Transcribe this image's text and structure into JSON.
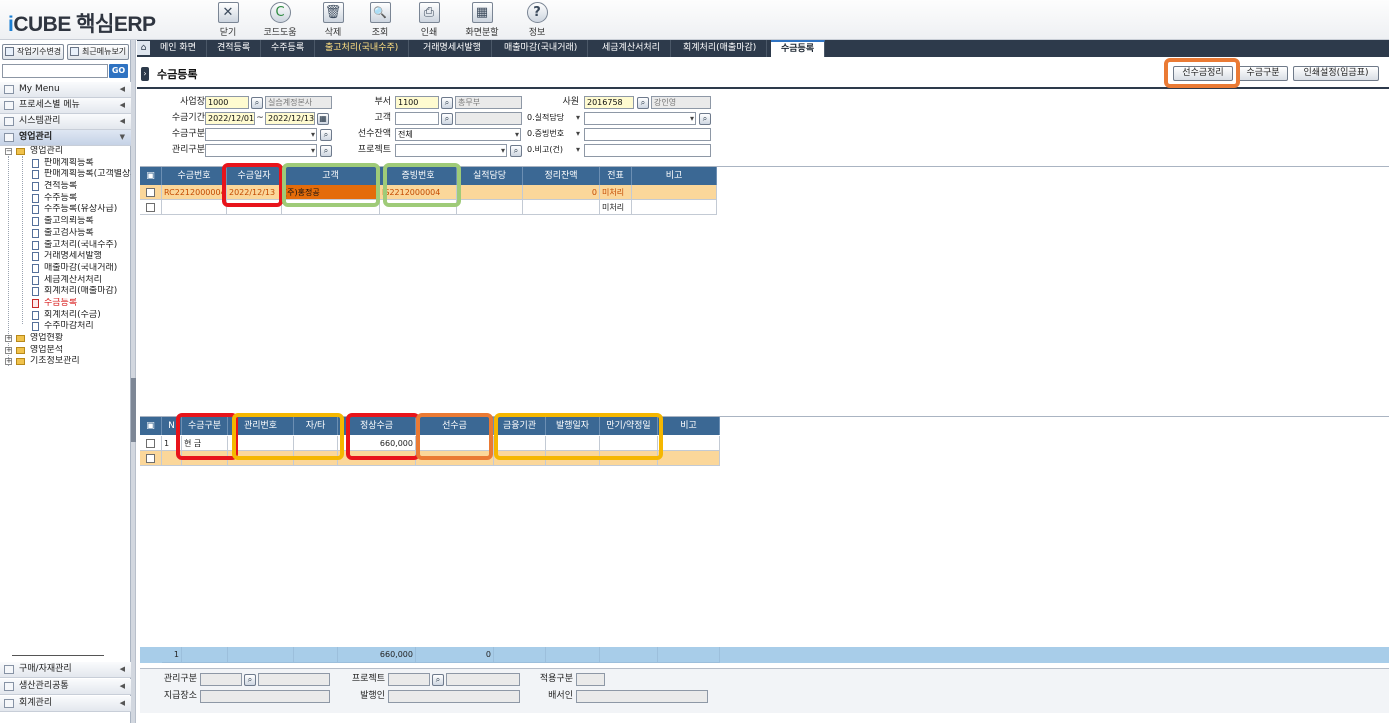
{
  "app": {
    "logo_prefix": "i",
    "logo_text": "CUBE 핵심ERP"
  },
  "toolbar": [
    {
      "label": "닫기",
      "icon": "close-icon",
      "glyph": "✕"
    },
    {
      "label": "코드도움",
      "icon": "code-help-icon",
      "glyph": "C"
    },
    {
      "label": "삭제",
      "icon": "delete-icon",
      "glyph": "🗑"
    },
    {
      "label": "조회",
      "icon": "search-icon",
      "glyph": "🔍"
    },
    {
      "label": "인쇄",
      "icon": "print-icon",
      "glyph": "⎙"
    },
    {
      "label": "화면분할",
      "icon": "split-screen-icon",
      "glyph": "▦"
    },
    {
      "label": "정보",
      "icon": "info-icon",
      "glyph": "?"
    }
  ],
  "sidebar": {
    "btn_change_company": "작업기수변경",
    "btn_recent_menu": "최근메뉴보기",
    "search_placeholder": "",
    "go_label": "GO",
    "sections_top": [
      {
        "label": "My Menu"
      },
      {
        "label": "프로세스별 메뉴"
      },
      {
        "label": "시스템관리"
      },
      {
        "label": "영업관리"
      }
    ],
    "tree": [
      {
        "label": "영업관리",
        "level": 0,
        "expanded": true
      },
      {
        "label": "판매계획등록",
        "level": 1
      },
      {
        "label": "판매계획등록(고객별상세)",
        "level": 1
      },
      {
        "label": "견적등록",
        "level": 1
      },
      {
        "label": "수주등록",
        "level": 1
      },
      {
        "label": "수주등록(유상사급)",
        "level": 1
      },
      {
        "label": "출고의뢰등록",
        "level": 1
      },
      {
        "label": "출고검사등록",
        "level": 1
      },
      {
        "label": "출고처리(국내수주)",
        "level": 1
      },
      {
        "label": "거래명세서발행",
        "level": 1
      },
      {
        "label": "매출마감(국내거래)",
        "level": 1
      },
      {
        "label": "세금계산서처리",
        "level": 1
      },
      {
        "label": "회계처리(매출마감)",
        "level": 1
      },
      {
        "label": "수금등록",
        "level": 1,
        "selected": true
      },
      {
        "label": "회계처리(수금)",
        "level": 1
      },
      {
        "label": "수주마감처리",
        "level": 1
      },
      {
        "label": "영업현황",
        "level": 0,
        "expanded": false
      },
      {
        "label": "영업분석",
        "level": 0,
        "expanded": false
      },
      {
        "label": "기초정보관리",
        "level": 0,
        "expanded": false
      }
    ],
    "sections_bottom": [
      {
        "label": "구매/자재관리"
      },
      {
        "label": "생산관리공통"
      },
      {
        "label": "회계관리"
      }
    ]
  },
  "tabs": [
    {
      "label": "메인 화면"
    },
    {
      "label": "견적등록"
    },
    {
      "label": "수주등록"
    },
    {
      "label": "출고처리(국내수주)",
      "highlight": true
    },
    {
      "label": "거래명세서발행"
    },
    {
      "label": "매출마감(국내거래)"
    },
    {
      "label": "세금계산서처리"
    },
    {
      "label": "회계처리(매출마감)"
    },
    {
      "label": "수금등록",
      "active": true
    }
  ],
  "page": {
    "title": "수금등록",
    "btn_advance_settle": "선수금정리",
    "btn_receipt_type": "수금구분",
    "btn_print_settings": "인쇄설정(입금표)"
  },
  "form": {
    "business_label": "사업장",
    "business_code": "1000",
    "business_name": "실습계정본사",
    "dept_label": "부서",
    "dept_code": "1100",
    "dept_name": "총무부",
    "emp_label": "사원",
    "emp_code": "2016758",
    "emp_name": "강인영",
    "period_label": "수금기간",
    "period_from": "2022/12/01",
    "period_tilde": "~",
    "period_to": "2022/12/13",
    "customer_label": "고객",
    "customer_code": "",
    "customer_name": "",
    "perf_owner_select": "0.실적담당",
    "perf_owner_value": "",
    "receipt_type_label": "수금구분",
    "receipt_type_value": "",
    "advance_balance_label": "선수잔액",
    "advance_balance_value": "전체",
    "evidence_select": "0.증빙번호",
    "evidence_value": "",
    "mgmt_type_label": "관리구분",
    "mgmt_type_value": "",
    "project_label": "프로젝트",
    "project_value": "",
    "remark_select": "0.비고(건)",
    "remark_value": ""
  },
  "grid1": {
    "headers": [
      "수금번호",
      "수금일자",
      "고객",
      "증빙번호",
      "실적담당",
      "정리잔액",
      "전표",
      "비고"
    ],
    "rows": [
      {
        "no": "RC2212000004",
        "date": "2022/12/13",
        "customer": "(주)홍정공",
        "evidence": "IS2212000004",
        "owner": "",
        "balance": "0",
        "slip": "미처리",
        "remark": ""
      },
      {
        "no": "",
        "date": "",
        "customer": "",
        "evidence": "",
        "owner": "",
        "balance": "",
        "slip": "미처리",
        "remark": ""
      }
    ]
  },
  "grid2": {
    "headers": [
      "N",
      "수금구분",
      "관리번호",
      "자/타",
      "정상수금",
      "선수금",
      "금융기관",
      "발행일자",
      "만기/약정일",
      "비고"
    ],
    "rows": [
      {
        "n": "1",
        "type": "현      금",
        "mgmt": "",
        "self": "",
        "normal": "660,000",
        "advance": "",
        "bank": "",
        "issue": "",
        "due": "",
        "remark": ""
      },
      {
        "n": "",
        "type": "",
        "mgmt": "",
        "self": "",
        "normal": "",
        "advance": "",
        "bank": "",
        "issue": "",
        "due": "",
        "remark": ""
      }
    ],
    "totals": {
      "n": "1",
      "normal": "660,000",
      "advance": "0"
    }
  },
  "footer": {
    "mgmt_type_label": "관리구분",
    "project_label": "프로젝트",
    "apply_type_label": "적용구분",
    "pay_place_label": "지급장소",
    "issuer_label": "발행인",
    "endorser_label": "배서인"
  },
  "colors": {
    "header_blue": "#3b6894",
    "selected_row": "#fbd79a",
    "highlight_red": "#e8141b",
    "highlight_green": "#9fcb78",
    "highlight_orange": "#ea7a34",
    "highlight_yellow": "#f5b700"
  }
}
